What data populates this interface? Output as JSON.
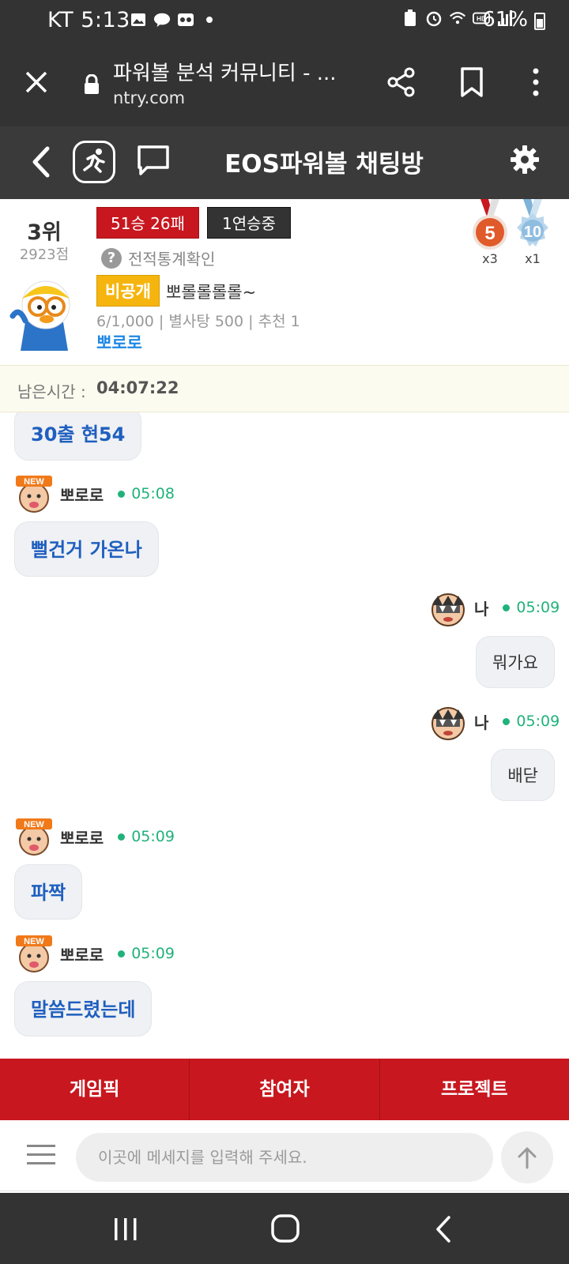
{
  "status_bar": {
    "carrier": "KT",
    "time": "5:13",
    "battery": "61%"
  },
  "browser": {
    "page_title": "파워볼 분석 커뮤니티 - ...",
    "url": "ntry.com"
  },
  "app_header": {
    "title": "EOS파워볼 채팅방"
  },
  "profile": {
    "rank": "3위",
    "points": "2923점",
    "record": "51승 26패",
    "streak": "1연승중",
    "stats_link": "전적통계확인",
    "medals": [
      {
        "label": "5",
        "count": "x3"
      },
      {
        "label": "10",
        "count": "x1"
      }
    ],
    "visibility_tag": "비공개",
    "status_message": "뽀롤롤롤롤~",
    "meta": "6/1,000 | 별사탕 500 | 추천 1",
    "name": "뽀로로"
  },
  "timer": {
    "label": "남은시간 :",
    "value": "04:07:22"
  },
  "messages": [
    {
      "sender": "",
      "time": "",
      "text": "30출 현54",
      "mine": false
    },
    {
      "sender": "뽀로로",
      "time": "05:08",
      "text": "뻘건거 가온나",
      "mine": false
    },
    {
      "sender": "나",
      "time": "05:09",
      "text": "뭐가요",
      "mine": true
    },
    {
      "sender": "나",
      "time": "05:09",
      "text": "배닫",
      "mine": true
    },
    {
      "sender": "뽀로로",
      "time": "05:09",
      "text": "파짝",
      "mine": false
    },
    {
      "sender": "뽀로로",
      "time": "05:09",
      "text": "말씀드렸는데",
      "mine": false
    }
  ],
  "tabs": [
    "게임픽",
    "참여자",
    "프로젝트"
  ],
  "input": {
    "placeholder": "이곳에 메세지를 입력해 주세요."
  },
  "icons": {
    "close": "close-icon",
    "lock": "lock-icon",
    "share": "share-icon",
    "bookmark": "bookmark-icon",
    "more": "more-vertical-icon",
    "back": "chevron-left-icon",
    "runner": "runner-icon",
    "chat": "chat-bubble-icon",
    "settings": "gear-icon",
    "menu": "hamburger-icon",
    "send": "arrow-up-icon"
  },
  "colors": {
    "accent_red": "#c8171f",
    "header_dark": "#3a3a3a",
    "online_green": "#20b27a",
    "message_blue": "#1f5fbf",
    "private_yellow": "#f6b50e",
    "link_blue": "#1e88e5"
  }
}
